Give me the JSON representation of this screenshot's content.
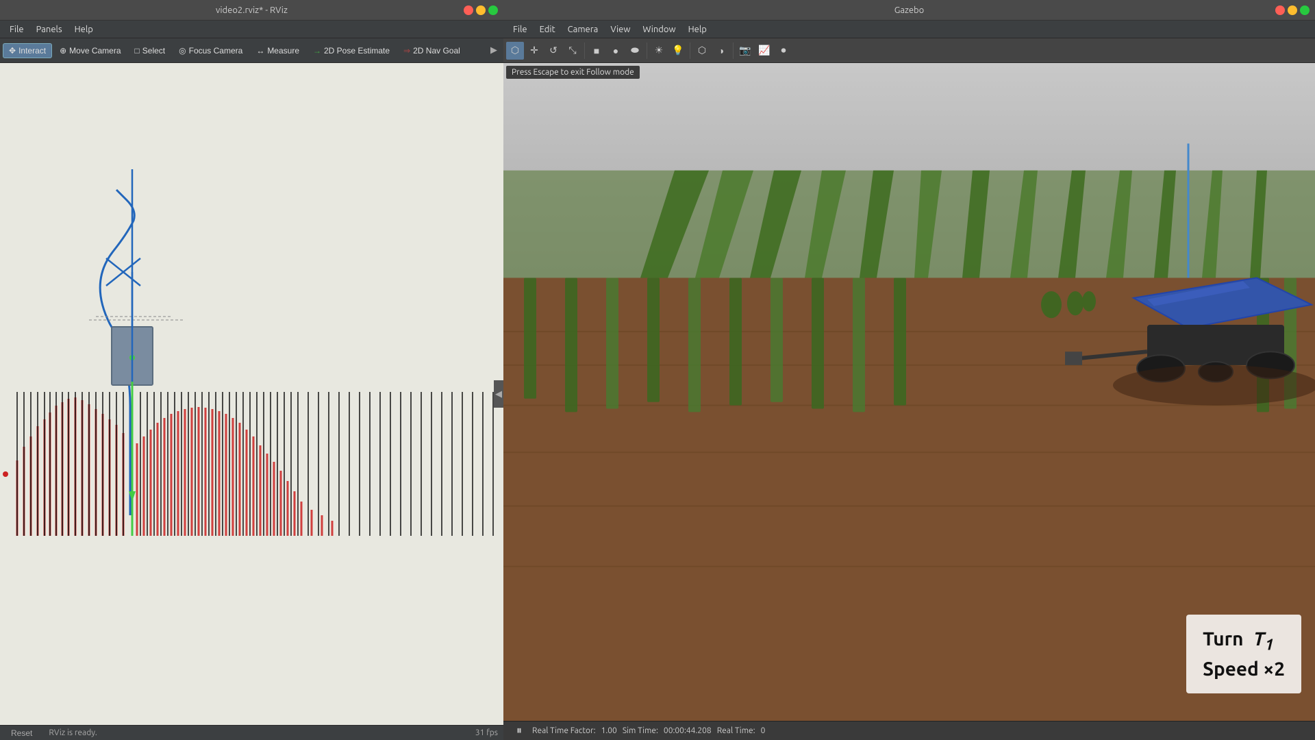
{
  "rviz": {
    "title": "video2.rviz* - RViz",
    "menu": {
      "items": [
        "File",
        "Panels",
        "Help"
      ]
    },
    "toolbar": {
      "tools": [
        {
          "id": "interact",
          "label": "Interact",
          "icon": "✥",
          "active": true
        },
        {
          "id": "move-camera",
          "label": "Move Camera",
          "icon": "⊕",
          "active": false
        },
        {
          "id": "select",
          "label": "Select",
          "icon": "□",
          "active": false
        },
        {
          "id": "focus-camera",
          "label": "Focus Camera",
          "icon": "◎",
          "active": false
        },
        {
          "id": "measure",
          "label": "Measure",
          "icon": "↔",
          "active": false
        },
        {
          "id": "pose-estimate",
          "label": "2D Pose Estimate",
          "icon": "→",
          "active": false
        },
        {
          "id": "nav-goal",
          "label": "2D Nav Goal",
          "icon": "⇒",
          "active": false
        }
      ]
    },
    "status": {
      "reset": "Reset",
      "message": "RViz is ready.",
      "fps": "31 fps"
    }
  },
  "gazebo": {
    "title": "Gazebo",
    "menu": {
      "items": [
        "File",
        "Edit",
        "Camera",
        "View",
        "Window",
        "Help"
      ]
    },
    "escape_hint": "Press Escape to exit Follow mode",
    "status": {
      "real_time_factor_label": "Real Time Factor:",
      "real_time_factor": "1.00",
      "sim_time_label": "Sim Time:",
      "sim_time": "00:00:44.208",
      "real_time_label": "Real Time:",
      "real_time": "0"
    },
    "overlay": {
      "line1": "Turn",
      "t1": "T₁",
      "line2": "Speed ×2"
    }
  }
}
